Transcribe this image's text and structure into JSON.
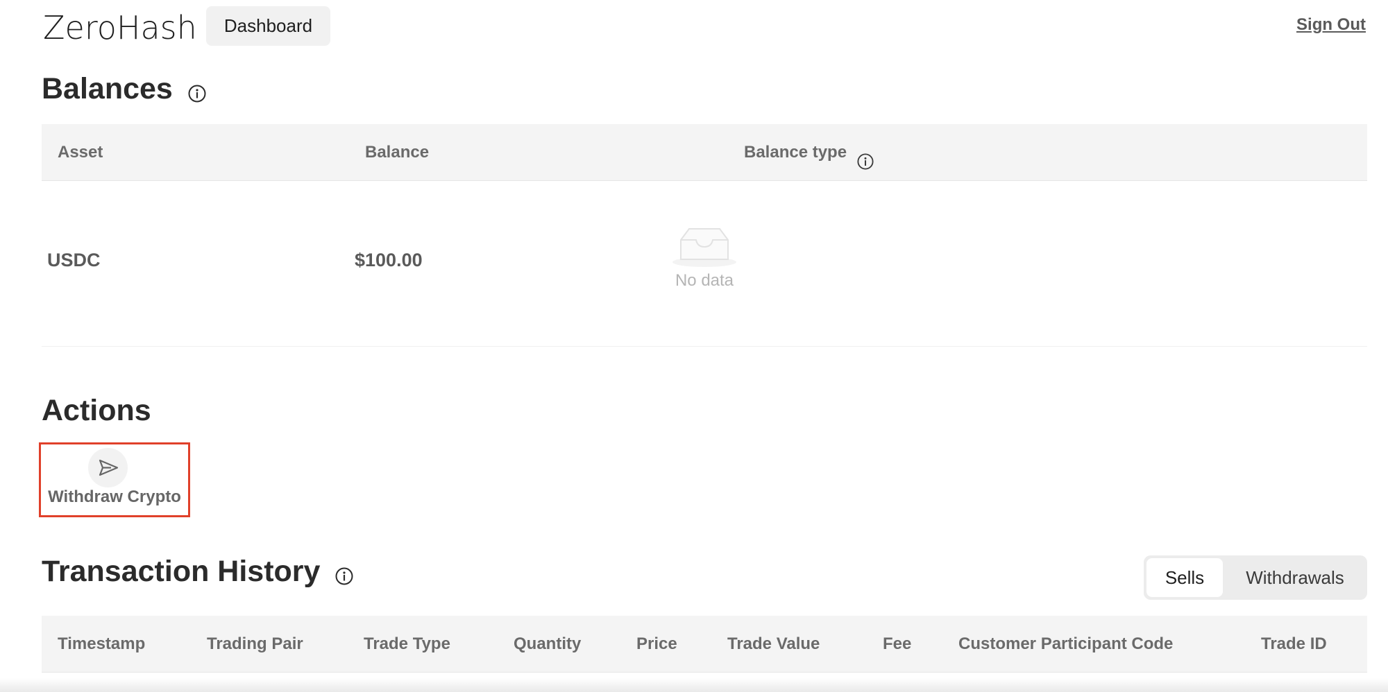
{
  "header": {
    "logo_text": "ZeroHash",
    "nav_dashboard": "Dashboard",
    "sign_out": "Sign Out"
  },
  "balances": {
    "title": "Balances",
    "columns": [
      "Asset",
      "Balance",
      "Balance type"
    ],
    "rows": [
      {
        "asset": "USDC",
        "balance": "$100.00",
        "balance_type": ""
      }
    ],
    "empty_text": "No data"
  },
  "actions": {
    "title": "Actions",
    "items": [
      {
        "label": "Withdraw Crypto",
        "icon": "send-icon"
      }
    ]
  },
  "transaction_history": {
    "title": "Transaction History",
    "tabs": [
      {
        "label": "Sells",
        "active": true
      },
      {
        "label": "Withdrawals",
        "active": false
      }
    ],
    "columns": [
      "Timestamp",
      "Trading Pair",
      "Trade Type",
      "Quantity",
      "Price",
      "Trade Value",
      "Fee",
      "Customer Participant Code",
      "Trade ID"
    ]
  },
  "colors": {
    "highlight_border": "#e0402a",
    "header_bg": "#f4f4f4",
    "text_primary": "#2b2b2b",
    "text_muted": "#6a6a6a"
  }
}
